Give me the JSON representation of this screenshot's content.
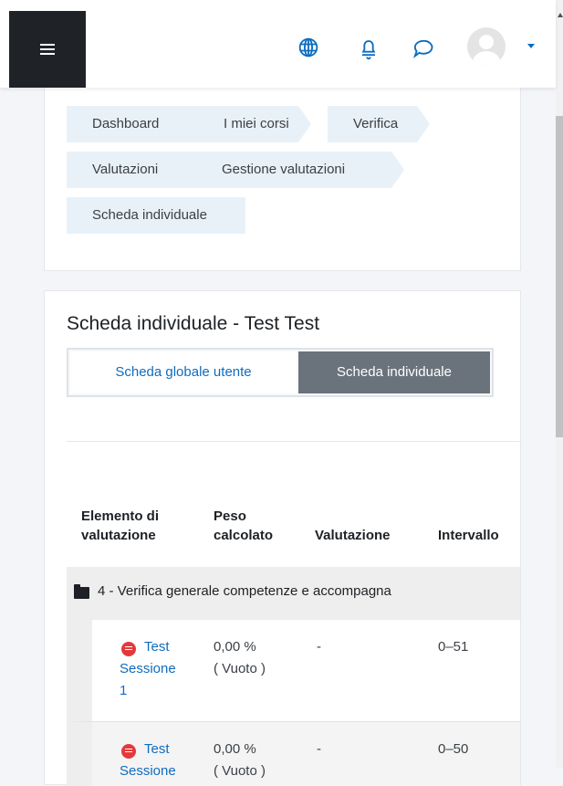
{
  "navbar": {
    "menu_icon": "hamburger-icon",
    "icons": [
      "globe-icon",
      "bell-icon",
      "chat-icon"
    ],
    "avatar_icon": "user-avatar-icon",
    "caret_icon": "caret-down-icon"
  },
  "breadcrumb": {
    "items": [
      "Dashboard",
      "I miei corsi",
      "Verifica",
      "Valutazioni",
      "Gestione valutazioni",
      "Scheda individuale"
    ]
  },
  "main": {
    "title": "Scheda individuale - Test Test",
    "tabs": [
      {
        "label": "Scheda globale utente",
        "active": false
      },
      {
        "label": "Scheda individuale",
        "active": true
      }
    ]
  },
  "table": {
    "headers": {
      "item": [
        "Elemento di",
        "valutazione"
      ],
      "weight": [
        "Peso",
        "calcolato"
      ],
      "grade": "Valutazione",
      "range": "Intervallo"
    },
    "category": "4 - Verifica generale competenze e accompagna",
    "rows": [
      {
        "name": [
          "Test",
          "Sessione",
          "1"
        ],
        "weight": [
          "0,00 %",
          "( Vuoto )"
        ],
        "grade": "-",
        "range": "0–51"
      },
      {
        "name": [
          "Test",
          "Sessione"
        ],
        "weight": [
          "0,00 %",
          "( Vuoto )"
        ],
        "grade": "-",
        "range": "0–50"
      }
    ]
  },
  "colors": {
    "accent": "#0f6cbf",
    "dark": "#1f2327",
    "active_tab": "#6a737b",
    "quiz_icon": "#e4393c"
  }
}
